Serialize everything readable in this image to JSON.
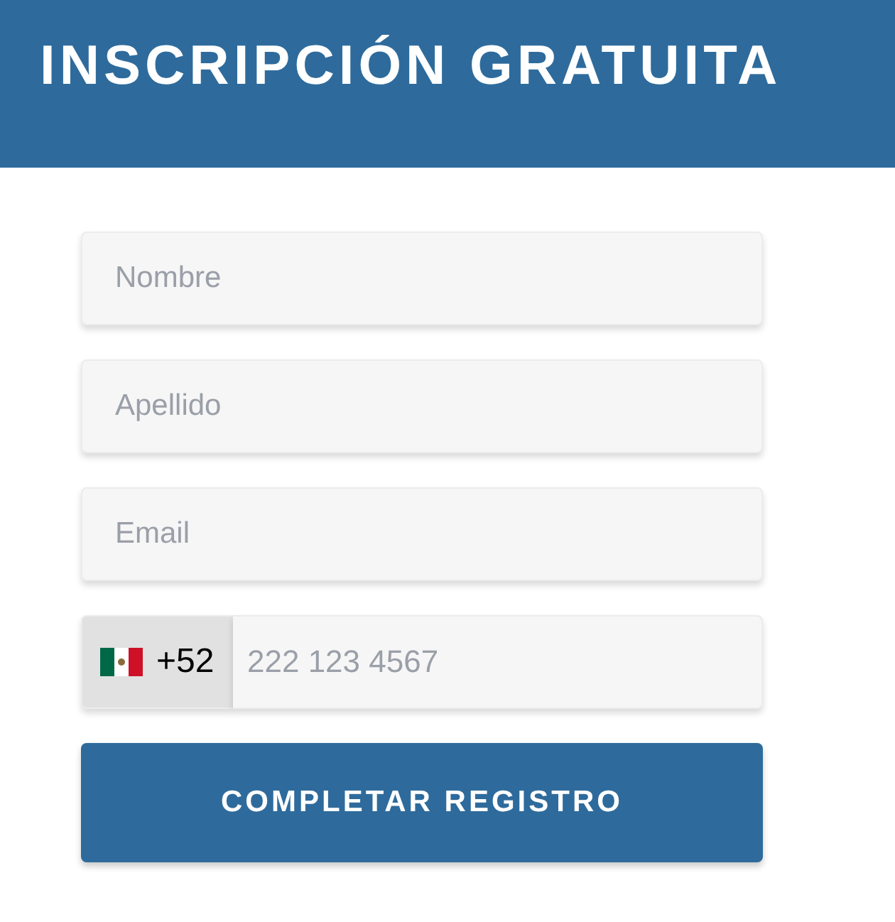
{
  "header": {
    "title": "INSCRIPCIÓN GRATUITA"
  },
  "fields": [
    {
      "placeholder": "Nombre"
    },
    {
      "placeholder": "Apellido"
    },
    {
      "placeholder": "Email"
    }
  ],
  "phone": {
    "code": "+52",
    "placeholder": "222 123 4567"
  },
  "submit": {
    "label": "COMPLETAR REGISTRO"
  }
}
